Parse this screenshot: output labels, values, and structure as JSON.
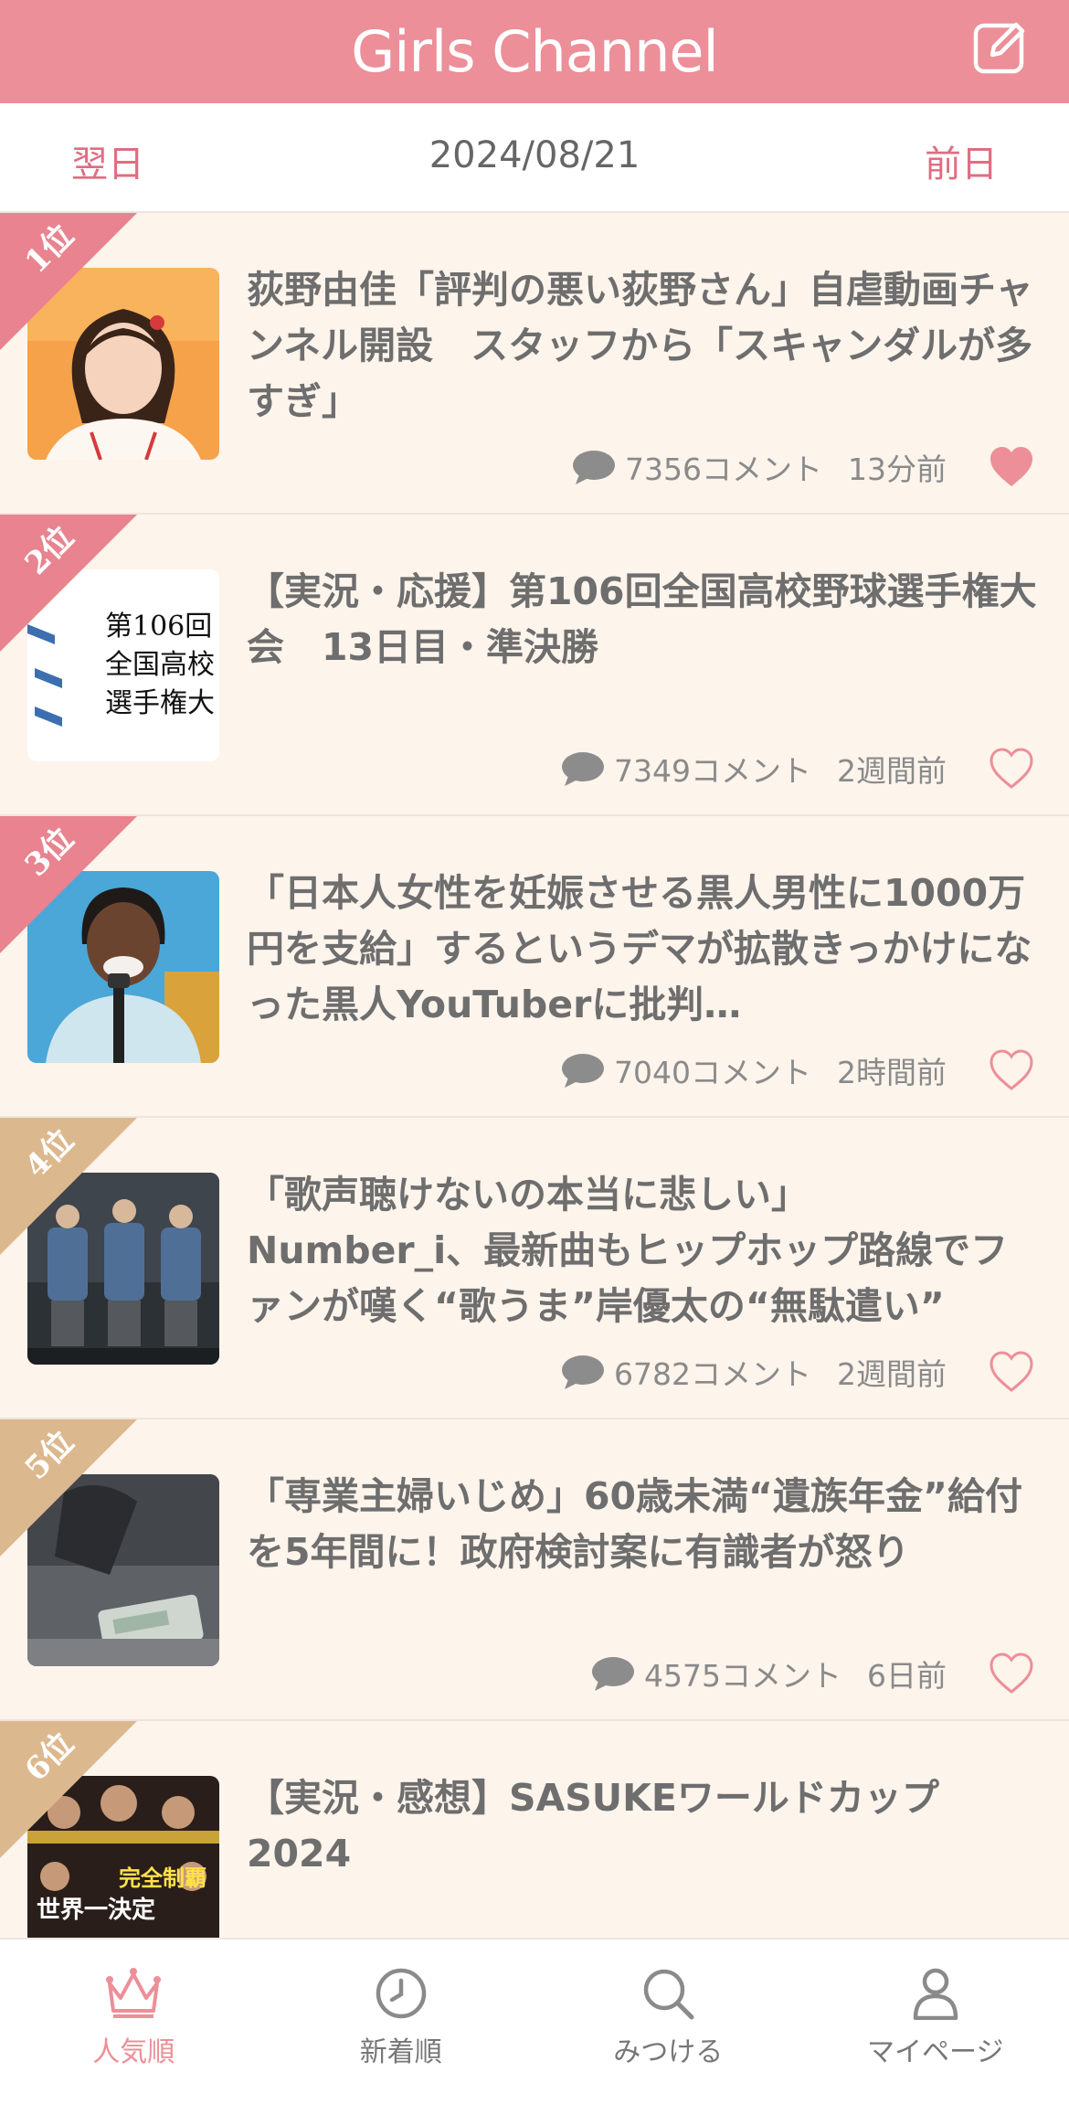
{
  "header": {
    "title": "Girls Channel"
  },
  "datebar": {
    "prev": "翌日",
    "current": "2024/08/21",
    "next": "前日"
  },
  "items": [
    {
      "rank": "1位",
      "title": "荻野由佳「評判の悪い荻野さん」自虐動画チャンネル開設　スタッフから「スキャンダルが多すぎ」",
      "comments": "7356コメント",
      "time": "13分前",
      "favorited": true
    },
    {
      "rank": "2位",
      "title": "【実況・応援】第106回全国高校野球選手権大会　13日目・準決勝",
      "comments": "7349コメント",
      "time": "2週間前",
      "favorited": false,
      "thumb_text": [
        "第106回",
        "全国高校",
        "選手権大"
      ]
    },
    {
      "rank": "3位",
      "title": "「日本人女性を妊娠させる黒人男性に1000万円を支給」するというデマが拡散きっかけになった黒人YouTuberに批判…",
      "comments": "7040コメント",
      "time": "2時間前",
      "favorited": false
    },
    {
      "rank": "4位",
      "title": "「歌声聴けないの本当に悲しい」Number_i、最新曲もヒップホップ路線でファンが嘆く“歌うま”岸優太の“無駄遣い”",
      "comments": "6782コメント",
      "time": "2週間前",
      "favorited": false
    },
    {
      "rank": "5位",
      "title": "「専業主婦いじめ」60歳未満“遺族年金”給付を5年間に！政府検討案に有識者が怒り",
      "comments": "4575コメント",
      "time": "6日前",
      "favorited": false
    },
    {
      "rank": "6位",
      "title": "【実況・感想】SASUKEワールドカップ2024",
      "comments": "",
      "time": "",
      "favorited": false,
      "thumb_text": [
        "世界一決定",
        "完全制覇"
      ]
    }
  ],
  "tabs": [
    {
      "label": "人気順",
      "icon": "crown-icon",
      "active": true
    },
    {
      "label": "新着順",
      "icon": "clock-icon",
      "active": false
    },
    {
      "label": "みつける",
      "icon": "search-icon",
      "active": false
    },
    {
      "label": "マイページ",
      "icon": "person-icon",
      "active": false
    }
  ],
  "colors": {
    "brand": "#ec8f98",
    "rank_top": "#e8838f",
    "rank_other": "#dcb88e",
    "heart": "#ec8f98"
  }
}
